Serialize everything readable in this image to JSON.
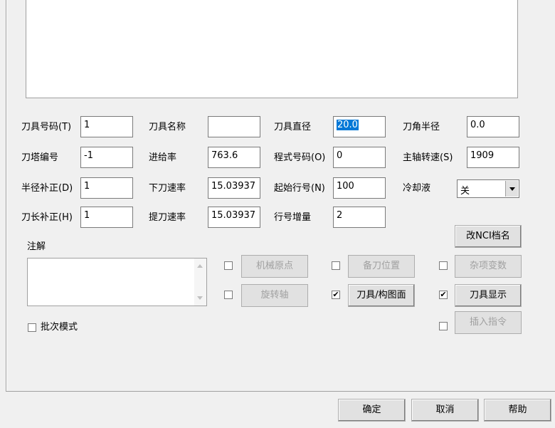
{
  "labels": {
    "tool_number": "刀具号码(T)",
    "tool_name": "刀具名称",
    "tool_diameter": "刀具直径",
    "corner_radius": "刀角半径",
    "turret_number": "刀塔编号",
    "feed_rate": "进给率",
    "program_number": "程式号码(O)",
    "spindle_speed": "主轴转速(S)",
    "radius_comp": "半径补正(D)",
    "plunge_rate": "下刀速率",
    "start_seq": "起始行号(N)",
    "coolant": "冷却液",
    "length_comp": "刀长补正(H)",
    "retract_rate": "提刀速率",
    "seq_increment": "行号增量",
    "comment": "注解"
  },
  "values": {
    "tool_number": "1",
    "tool_name": "",
    "tool_diameter": "20.0",
    "corner_radius": "0.0",
    "turret_number": "-1",
    "feed_rate": "763.6",
    "program_number": "0",
    "spindle_speed": "1909",
    "radius_comp": "1",
    "plunge_rate": "15.03937",
    "start_seq": "100",
    "coolant": "关",
    "length_comp": "1",
    "retract_rate": "15.03937",
    "seq_increment": "2"
  },
  "buttons": {
    "change_nci": "改NCI档名",
    "machine_origin": "机械原点",
    "spare_position": "备刀位置",
    "misc_values": "杂项变数",
    "rotary_axis": "旋转轴",
    "tool_plane": "刀具/构图面",
    "tool_display": "刀具显示",
    "insert_command": "插入指令",
    "ok": "确定",
    "cancel": "取消",
    "help": "帮助"
  },
  "checkboxes": {
    "batch_mode": "批次模式",
    "machine_origin": false,
    "spare_position": false,
    "misc_values": false,
    "rotary_axis": false,
    "tool_plane": true,
    "tool_display": true,
    "insert_command": false
  },
  "check_glyph": "✔"
}
